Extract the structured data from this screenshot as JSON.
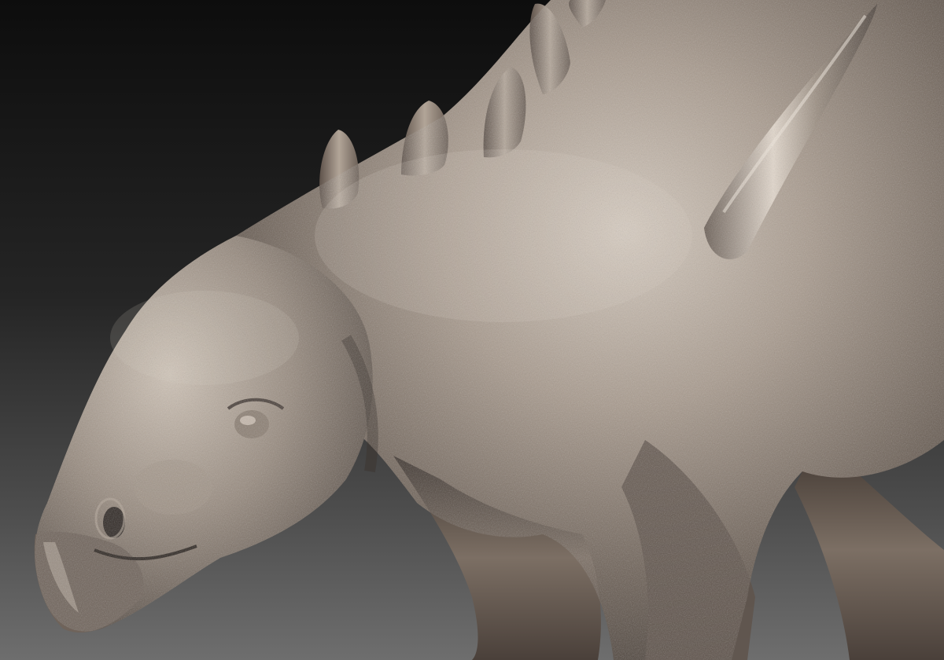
{
  "scene": {
    "subject_icon": "dinosaur-sculpt-icon",
    "colors": {
      "background_top": "#0d0d0d",
      "background_bottom": "#6e6e6e",
      "skin_base": "#8a7d72",
      "skin_highlight": "#d6cbbf",
      "skin_shadow": "#3b332d",
      "plate_base": "#9a8d80",
      "spike_base": "#b8ab9d"
    }
  }
}
